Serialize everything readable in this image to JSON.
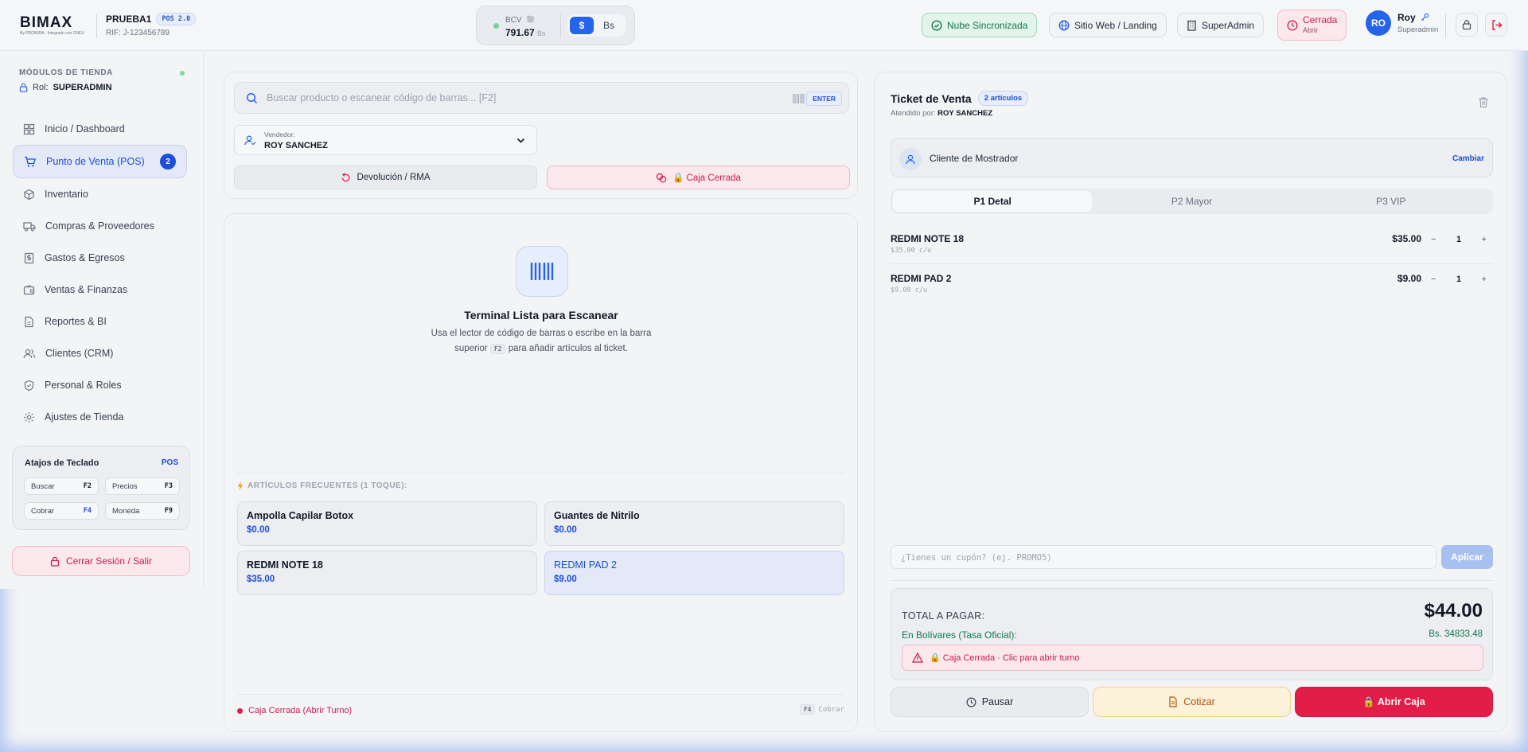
{
  "brand": {
    "logo": "BIMAX",
    "logo_sub": "By PROMIRA · Integrado con CNEX"
  },
  "store": {
    "name": "PRUEBA1",
    "version": "POS 2.0",
    "rif": "RIF: J-123456789"
  },
  "rate": {
    "label": "BCV",
    "value": "791.67",
    "unit": "Bs"
  },
  "currency": {
    "usd": "$",
    "bs": "Bs",
    "selected": "$"
  },
  "header": {
    "cloud": "Nube Sincronizada",
    "site": "Sitio Web / Landing",
    "superadmin": "SuperAdmin",
    "register_status": "Cerrada",
    "register_action": "Abrir"
  },
  "user": {
    "initials": "RO",
    "name": "Roy",
    "role": "Superadmin"
  },
  "sidebar": {
    "header": "MÓDULOS DE TIENDA",
    "role_label": "Rol:",
    "role_value": "SUPERADMIN",
    "items": [
      {
        "label": "Inicio / Dashboard",
        "icon": "dashboard-icon"
      },
      {
        "label": "Punto de Venta (POS)",
        "icon": "cart-icon",
        "badge": "2",
        "active": true
      },
      {
        "label": "Inventario",
        "icon": "box-icon"
      },
      {
        "label": "Compras & Proveedores",
        "icon": "truck-icon"
      },
      {
        "label": "Gastos & Egresos",
        "icon": "receipt-icon"
      },
      {
        "label": "Ventas & Finanzas",
        "icon": "wallet-icon"
      },
      {
        "label": "Reportes & BI",
        "icon": "report-icon"
      },
      {
        "label": "Clientes (CRM)",
        "icon": "users-icon"
      },
      {
        "label": "Personal & Roles",
        "icon": "shield-icon"
      },
      {
        "label": "Ajustes de Tienda",
        "icon": "gear-icon"
      }
    ],
    "shortcuts": {
      "title": "Atajos de Teclado",
      "tag": "POS",
      "keys": [
        {
          "label": "Buscar",
          "key": "F2"
        },
        {
          "label": "Precios",
          "key": "F3"
        },
        {
          "label": "Cobrar",
          "key": "F4"
        },
        {
          "label": "Moneda",
          "key": "F9"
        }
      ]
    },
    "logout": "Cerrar Sesión / Salir"
  },
  "center": {
    "search_placeholder": "Buscar producto o escanear código de barras... [F2]",
    "enter": "ENTER",
    "vendor_label": "Vendedor:",
    "vendor_value": "ROY SANCHEZ",
    "return_btn": "Devolución / RMA",
    "closed_btn": "🔒 Caja Cerrada",
    "scan_title": "Terminal Lista para Escanear",
    "scan_desc_a": "Usa el lector de código de barras o escribe en la barra superior",
    "scan_desc_key": "F2",
    "scan_desc_b": "para añadir artículos al ticket.",
    "freq_title": "ARTÍCULOS FRECUENTES (1 TOQUE):",
    "products": [
      {
        "name": "Ampolla Capilar Botox",
        "price": "$0.00"
      },
      {
        "name": "Guantes de Nitrilo",
        "price": "$0.00"
      },
      {
        "name": "REDMI NOTE 18",
        "price": "$35.00"
      },
      {
        "name": "REDMI PAD 2",
        "price": "$9.00"
      }
    ],
    "status": "Caja Cerrada (Abrir Turno)",
    "status_key": "F4",
    "status_key_label": "Cobrar"
  },
  "ticket": {
    "title": "Ticket de Venta",
    "count": "2 artículos",
    "attended_label": "Atendido por:",
    "attended_value": "ROY SANCHEZ",
    "customer": "Cliente de Mostrador",
    "change": "Cambiar",
    "price_tabs": [
      "P1 Detal",
      "P2 Mayor",
      "P3 VIP"
    ],
    "items": [
      {
        "name": "REDMI NOTE 18",
        "unit": "$35.00 c/u",
        "total": "$35.00",
        "qty": "1"
      },
      {
        "name": "REDMI PAD 2",
        "unit": "$9.00 c/u",
        "total": "$9.00",
        "qty": "1"
      }
    ],
    "coupon_placeholder": "¿Tienes un cupón? (ej. PROMO5)",
    "apply": "Aplicar",
    "total_label": "TOTAL A PAGAR:",
    "total_value": "$44.00",
    "bs_label": "En Bolívares (Tasa Oficial):",
    "bs_value": "Bs. 34833.48",
    "warning": "🔒 Caja Cerrada · Clic para abrir turno",
    "pause": "Pausar",
    "quote": "Cotizar",
    "open": "🔒 Abrir Caja"
  },
  "colors": {
    "primary": "#2563eb",
    "danger": "#e11d48",
    "success": "#13784a",
    "warning": "#b45309"
  }
}
